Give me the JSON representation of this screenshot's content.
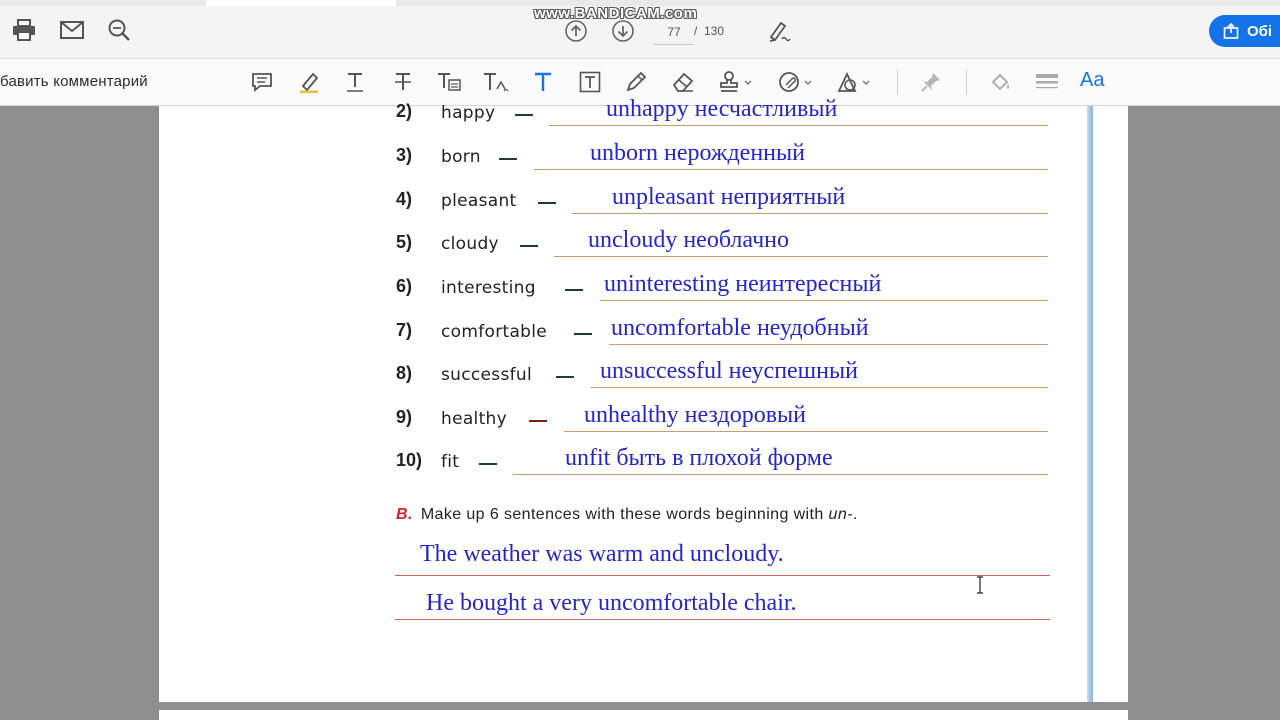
{
  "toolbar": {
    "watermark": "www.BANDICAM.com",
    "page_current": "77",
    "page_separator": "/",
    "page_total": "130",
    "share_label": "Обі"
  },
  "comment_toolbar": {
    "label": "бавить комментарий",
    "font_label": "Aa"
  },
  "exercise": {
    "items": [
      {
        "num": "2)",
        "word": "happy",
        "answer": "unhappy несчастливый"
      },
      {
        "num": "3)",
        "word": "born",
        "answer": "unborn нерожденный"
      },
      {
        "num": "4)",
        "word": "pleasant",
        "answer": "unpleasant неприятный"
      },
      {
        "num": "5)",
        "word": "cloudy",
        "answer": "uncloudy необлачно"
      },
      {
        "num": "6)",
        "word": "interesting",
        "answer": "uninteresting неинтересный"
      },
      {
        "num": "7)",
        "word": "comfortable",
        "answer": "uncomfortable неудобный"
      },
      {
        "num": "8)",
        "word": "successful",
        "answer": "unsuccessful неуспешный"
      },
      {
        "num": "9)",
        "word": "healthy",
        "answer": "unhealthy нездоровый"
      },
      {
        "num": "10)",
        "word": "fit",
        "answer": "unfit быть в плохой форме"
      }
    ],
    "task_b": {
      "letter": "B.",
      "text": "Make up 6 sentences with these words beginning with",
      "prefix": "un-",
      "end": "."
    },
    "sentences": [
      "The weather was warm and uncloudy.",
      "He bought a very uncomfortable chair."
    ]
  },
  "colors": {
    "accent": "#1473e6",
    "handwriting": "#2626c8",
    "task_letter": "#d4242b"
  }
}
